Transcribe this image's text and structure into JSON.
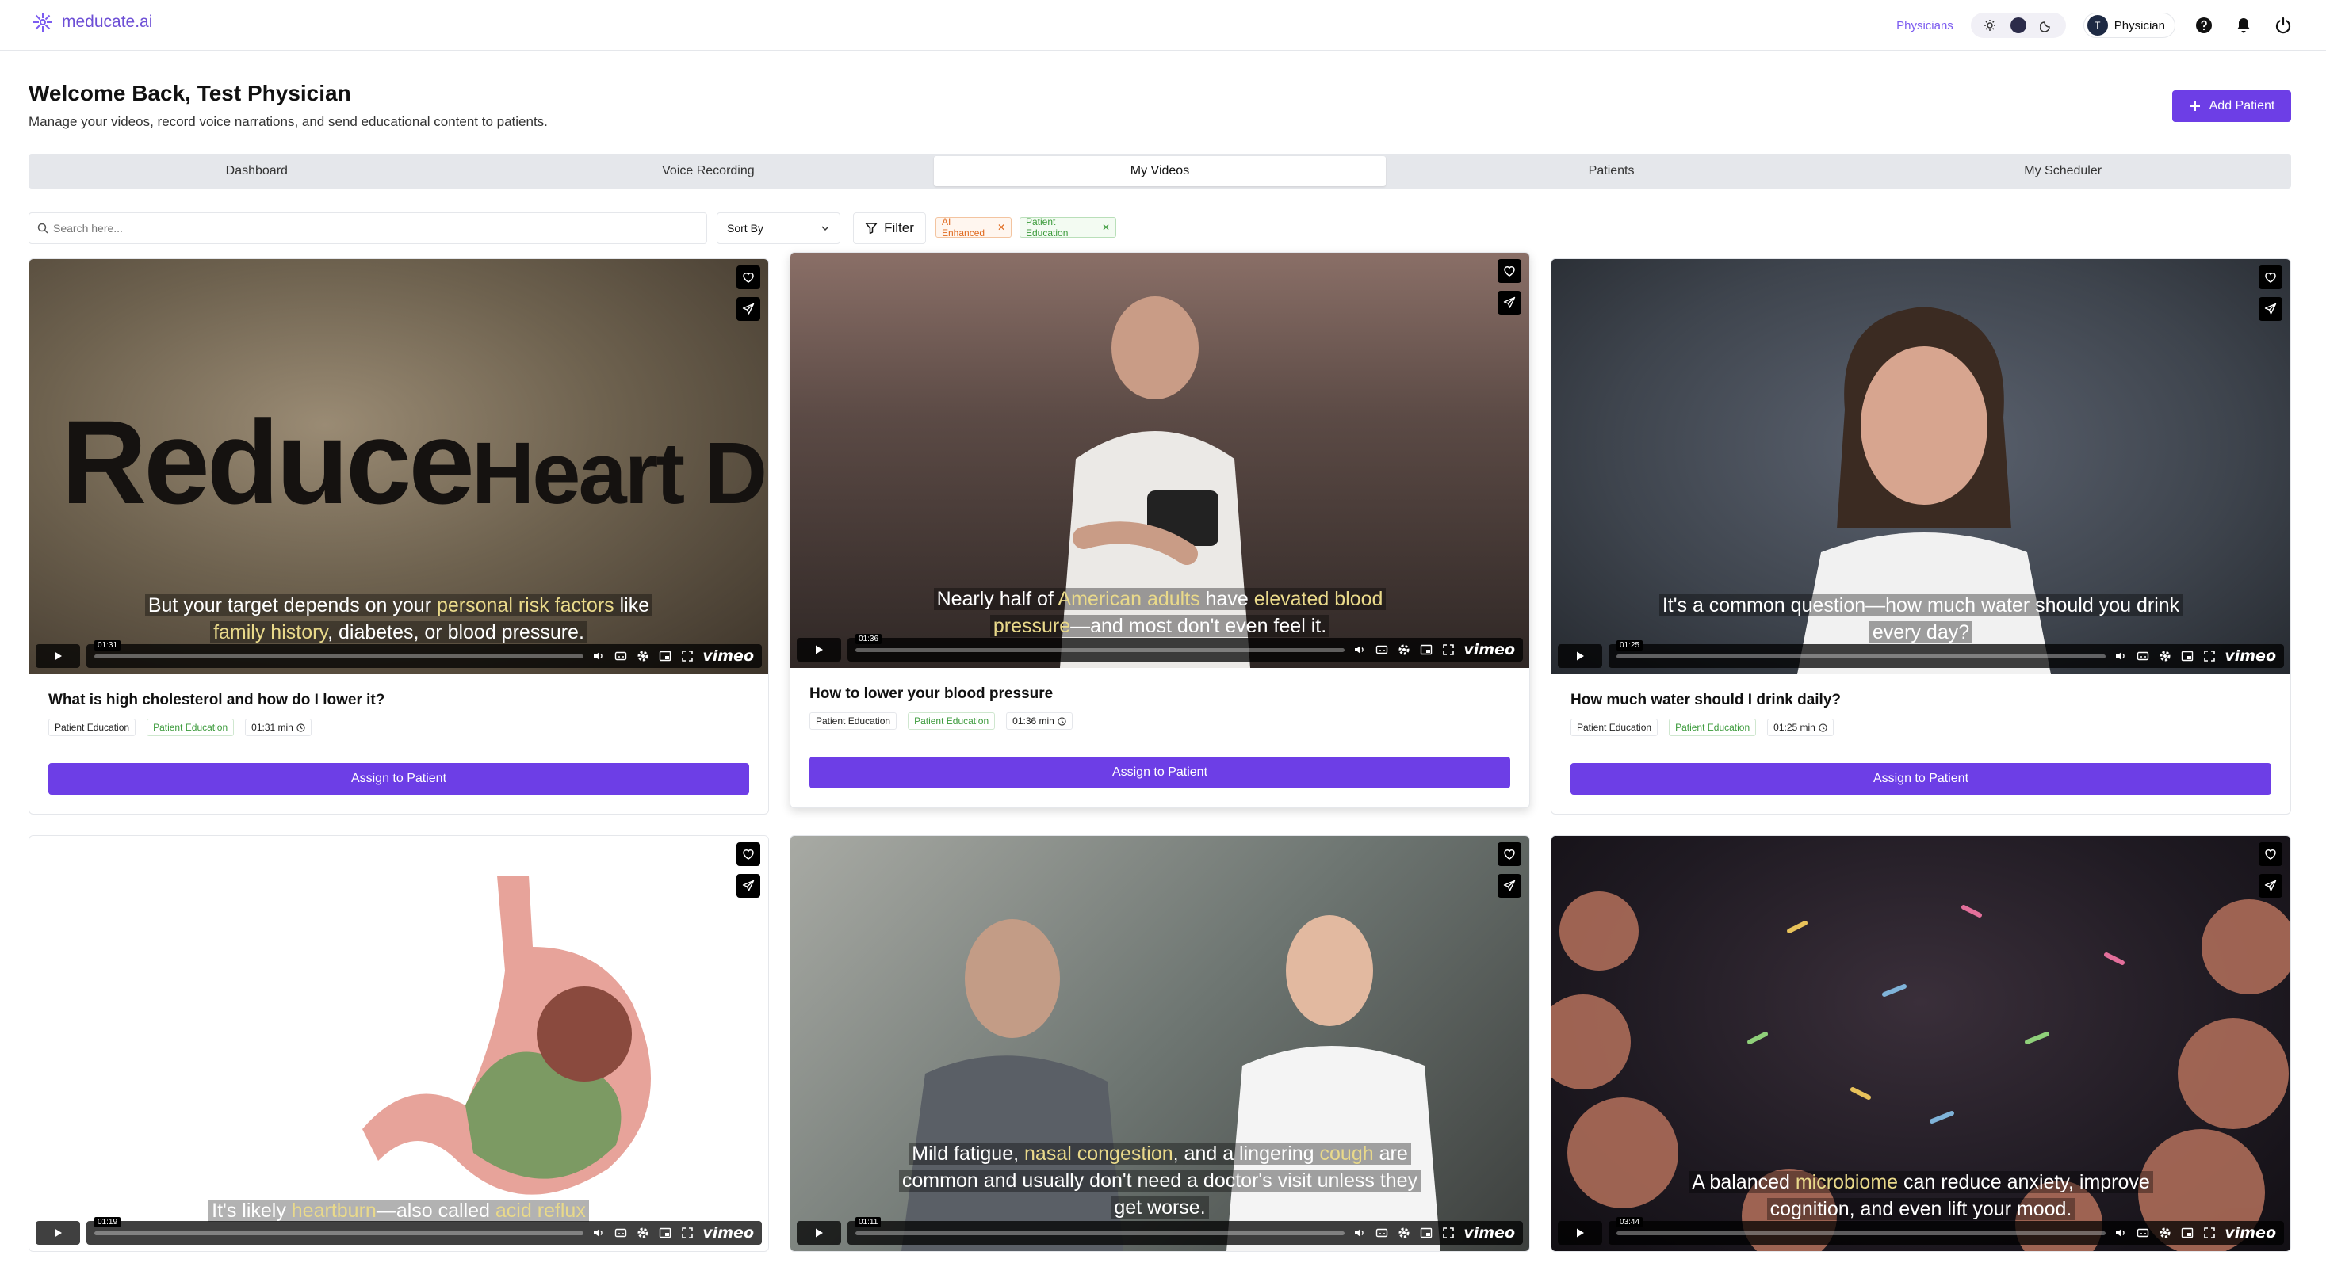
{
  "app": {
    "logo_text": "meducate.ai"
  },
  "nav": {
    "physicians_link": "Physicians",
    "user_initial": "T",
    "user_label": "Physician"
  },
  "header": {
    "title": "Welcome Back, Test Physician",
    "subtitle": "Manage your videos, record voice narrations, and send educational content to patients.",
    "add_patient_label": "Add Patient"
  },
  "tabs": [
    {
      "label": "Dashboard"
    },
    {
      "label": "Voice Recording"
    },
    {
      "label": "My Videos",
      "active": true
    },
    {
      "label": "Patients"
    },
    {
      "label": "My Scheduler"
    }
  ],
  "toolbar": {
    "search_placeholder": "Search here...",
    "sort_label": "Sort By",
    "filter_label": "Filter",
    "chips": [
      "AI Enhanced",
      "Patient Education"
    ]
  },
  "videos": [
    {
      "title": "What is high cholesterol and how do I lower it?",
      "tag1": "Patient Education",
      "tag2": "Patient Education",
      "duration": "01:31 min",
      "timecode": "01:31",
      "overlay_text_1": "Reduce",
      "overlay_text_2": "Heart Diseas",
      "caption_a": "But your target depends on your ",
      "caption_hl1": "personal risk factors",
      "caption_b": " like",
      "caption_hl2": "family history",
      "caption_c": ", diabetes, or blood pressure."
    },
    {
      "title": "How to lower your blood pressure",
      "tag1": "Patient Education",
      "tag2": "Patient Education",
      "duration": "01:36 min",
      "timecode": "01:36",
      "caption_a": "Nearly half of ",
      "caption_hl1": "American adults",
      "caption_b": " have ",
      "caption_hl2": "elevated blood",
      "caption_hl3": "pressure",
      "caption_c": "—and most don't even feel it."
    },
    {
      "title": "How much water should I drink daily?",
      "tag1": "Patient Education",
      "tag2": "Patient Education",
      "duration": "01:25 min",
      "timecode": "01:25",
      "caption_line1": "It's a common question—how much water should you drink",
      "caption_line2": "every day?"
    },
    {
      "title": "",
      "timecode": "01:19",
      "caption_a": "It's likely ",
      "caption_hl1": "heartburn",
      "caption_b": "—also called ",
      "caption_hl2": "acid reflux"
    },
    {
      "title": "",
      "timecode": "01:11",
      "caption_a": "Mild fatigue, ",
      "caption_hl1": "nasal congestion",
      "caption_b": ", and a lingering ",
      "caption_hl2": "cough",
      "caption_c": " are",
      "caption_line2": "common and usually don't need a doctor's visit unless they",
      "caption_line3": "get worse."
    },
    {
      "title": "",
      "timecode": "03:44",
      "caption_a": "A balanced ",
      "caption_hl1": "microbiome",
      "caption_b": " can reduce anxiety, improve",
      "caption_line2": "cognition, and even lift your mood."
    }
  ],
  "card_actions": {
    "assign_label": "Assign to Patient",
    "vimeo_label": "vimeo"
  }
}
